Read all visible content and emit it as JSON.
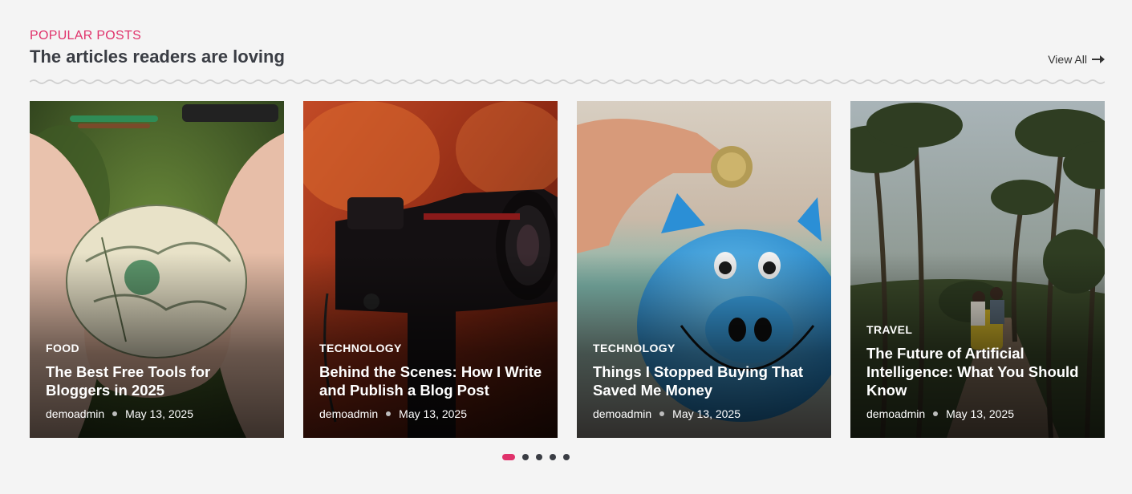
{
  "section": {
    "eyebrow": "POPULAR POSTS",
    "title": "The articles readers are loving",
    "view_all": "View All"
  },
  "colors": {
    "accent": "#e0326b",
    "heading": "#3a3d44",
    "background": "#f4f4f4"
  },
  "posts": [
    {
      "category": "FOOD",
      "title": "The Best Free Tools for Bloggers in 2025",
      "author": "demoadmin",
      "date": "May 13, 2025"
    },
    {
      "category": "TECHNOLOGY",
      "title": "Behind the Scenes: How I Write and Publish a Blog Post",
      "author": "demoadmin",
      "date": "May 13, 2025"
    },
    {
      "category": "TECHNOLOGY",
      "title": "Things I Stopped Buying That Saved Me Money",
      "author": "demoadmin",
      "date": "May 13, 2025"
    },
    {
      "category": "TRAVEL",
      "title": "The Future of Artificial Intelligence: What You Should Know",
      "author": "demoadmin",
      "date": "May 13, 2025"
    }
  ],
  "pagination": {
    "pages": 5,
    "active_index": 0
  }
}
